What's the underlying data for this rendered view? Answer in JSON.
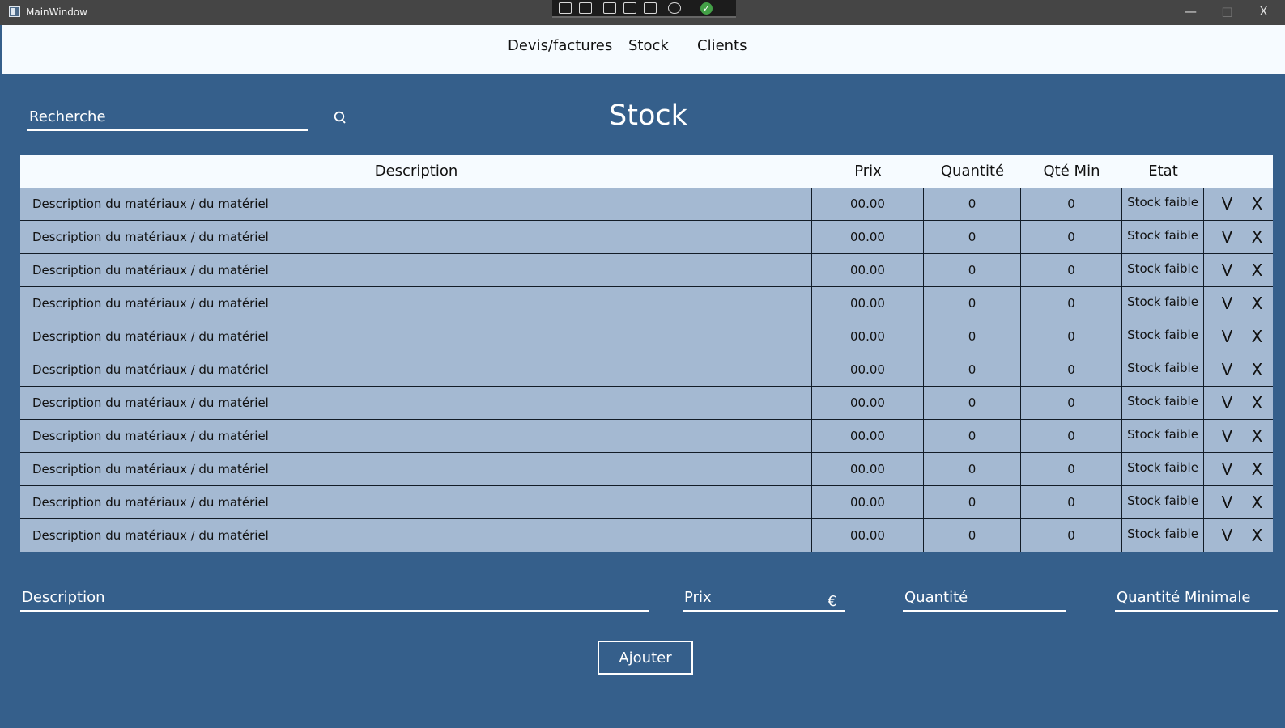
{
  "window": {
    "title": "MainWindow",
    "controls": {
      "minimize": "—",
      "maximize": "□",
      "close": "X"
    },
    "debug_toolbar": {
      "status_glyph": "✓"
    }
  },
  "nav": {
    "items": [
      "Devis/factures",
      "Stock",
      "Clients"
    ]
  },
  "search": {
    "placeholder": "Recherche"
  },
  "page": {
    "title": "Stock"
  },
  "table": {
    "columns": [
      "Description",
      "Prix",
      "Quantité",
      "Qté Min",
      "Etat"
    ],
    "rows": [
      {
        "description": "Description du matériaux / du matériel",
        "price": "00.00",
        "quantity": "0",
        "min_quantity": "0",
        "state": "Stock faible",
        "validate": "V",
        "delete": "X"
      },
      {
        "description": "Description du matériaux / du matériel",
        "price": "00.00",
        "quantity": "0",
        "min_quantity": "0",
        "state": "Stock faible",
        "validate": "V",
        "delete": "X"
      },
      {
        "description": "Description du matériaux / du matériel",
        "price": "00.00",
        "quantity": "0",
        "min_quantity": "0",
        "state": "Stock faible",
        "validate": "V",
        "delete": "X"
      },
      {
        "description": "Description du matériaux / du matériel",
        "price": "00.00",
        "quantity": "0",
        "min_quantity": "0",
        "state": "Stock faible",
        "validate": "V",
        "delete": "X"
      },
      {
        "description": "Description du matériaux / du matériel",
        "price": "00.00",
        "quantity": "0",
        "min_quantity": "0",
        "state": "Stock faible",
        "validate": "V",
        "delete": "X"
      },
      {
        "description": "Description du matériaux / du matériel",
        "price": "00.00",
        "quantity": "0",
        "min_quantity": "0",
        "state": "Stock faible",
        "validate": "V",
        "delete": "X"
      },
      {
        "description": "Description du matériaux / du matériel",
        "price": "00.00",
        "quantity": "0",
        "min_quantity": "0",
        "state": "Stock faible",
        "validate": "V",
        "delete": "X"
      },
      {
        "description": "Description du matériaux / du matériel",
        "price": "00.00",
        "quantity": "0",
        "min_quantity": "0",
        "state": "Stock faible",
        "validate": "V",
        "delete": "X"
      },
      {
        "description": "Description du matériaux / du matériel",
        "price": "00.00",
        "quantity": "0",
        "min_quantity": "0",
        "state": "Stock faible",
        "validate": "V",
        "delete": "X"
      },
      {
        "description": "Description du matériaux / du matériel",
        "price": "00.00",
        "quantity": "0",
        "min_quantity": "0",
        "state": "Stock faible",
        "validate": "V",
        "delete": "X"
      },
      {
        "description": "Description du matériaux / du matériel",
        "price": "00.00",
        "quantity": "0",
        "min_quantity": "0",
        "state": "Stock faible",
        "validate": "V",
        "delete": "X"
      }
    ]
  },
  "form": {
    "description_placeholder": "Description",
    "price_placeholder": "Prix",
    "currency": "€",
    "quantity_placeholder": "Quantité",
    "min_quantity_placeholder": "Quantité Minimale",
    "add_label": "Ajouter"
  },
  "colors": {
    "background": "#355f8b",
    "table_rows": "#a4b9d2",
    "header": "#f6fbff",
    "text_light": "#ffffff"
  },
  "icons": {
    "search": "search-icon",
    "app": "app-window-icon"
  }
}
